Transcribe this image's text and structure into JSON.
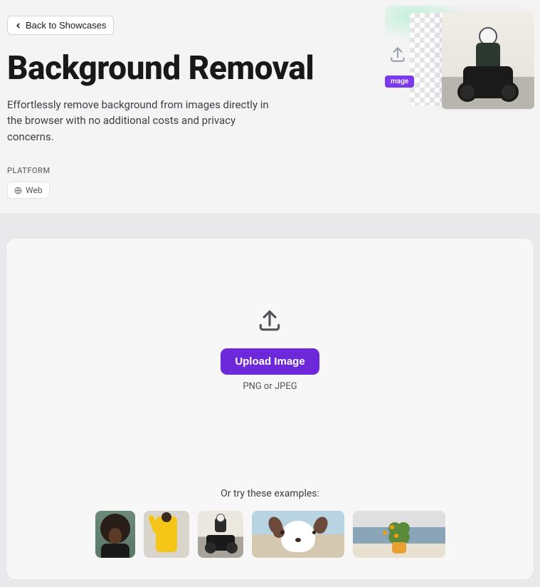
{
  "nav": {
    "back_label": "Back to Showcases"
  },
  "hero": {
    "title": "Background Removal",
    "description": "Effortlessly remove background from images directly in the browser with no additional costs and privacy concerns.",
    "badge": "mage"
  },
  "platform": {
    "section_label": "PLATFORM",
    "chip_label": "Web"
  },
  "upload": {
    "button_label": "Upload Image",
    "hint": "PNG or JPEG"
  },
  "examples": {
    "label": "Or try these examples:",
    "items": [
      {
        "name": "portrait-afro"
      },
      {
        "name": "yellow-outfit"
      },
      {
        "name": "motorcycle-rider"
      },
      {
        "name": "border-collie-dog"
      },
      {
        "name": "potted-plant-sea"
      }
    ]
  },
  "colors": {
    "accent": "#6d28d9"
  }
}
